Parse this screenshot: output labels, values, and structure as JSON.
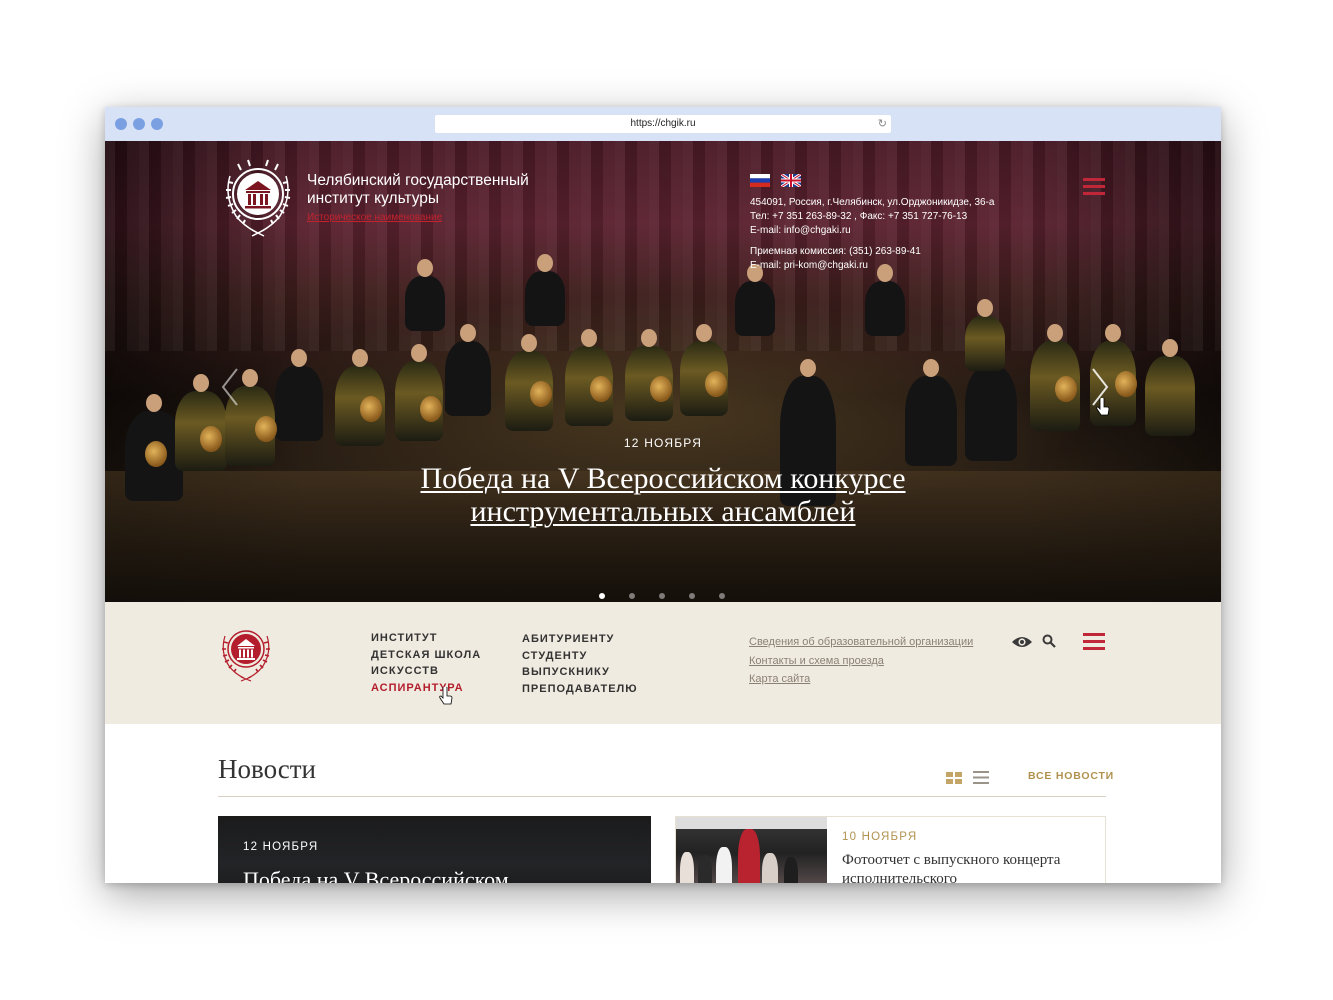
{
  "browser": {
    "url": "https://chgik.ru"
  },
  "header": {
    "institute_name": "Челябинский государственный институт культуры",
    "historical_name_link": "Историческое наименование",
    "contacts": {
      "address": "454091, Россия, г.Челябинск, ул.Орджоникидзе, 36-а",
      "phones": "Тел: +7 351 263-89-32 , Факс: +7 351 727-76-13",
      "email": "E-mail: info@chgaki.ru",
      "admissions": "Приемная комиссия: (351) 263-89-41",
      "admissions_email": "E-mail: pri-kom@chgaki.ru"
    },
    "languages": [
      "ru-flag-icon",
      "uk-flag-icon"
    ]
  },
  "hero": {
    "date": "12 НОЯБРЯ",
    "title": "Победа на V Всероссийском конкурсе инструментальных ансамблей",
    "slides_count": 5,
    "active_slide": 1
  },
  "nav": {
    "col1": [
      "Институт",
      "Детская школа",
      "искусств",
      "Аспирантура"
    ],
    "active_item": "Аспирантура",
    "col2": [
      "Абитуриенту",
      "Студенту",
      "Выпускнику",
      "Преподавателю"
    ],
    "links": [
      "Сведения об образовательной организации",
      "Контакты и схема проезда",
      "Карта сайта"
    ],
    "icons": [
      "eye-icon",
      "search-icon",
      "menu-icon"
    ]
  },
  "news": {
    "heading": "Новости",
    "all_news": "ВСЕ НОВОСТИ",
    "items": [
      {
        "date": "12 НОЯБРЯ",
        "title": "Победа на V Всероссийском"
      },
      {
        "date": "10 НОЯБРЯ",
        "title": "Фотоотчет с выпускного концерта исполнительского"
      }
    ]
  },
  "colors": {
    "accent_red": "#c0283a",
    "nav_background": "#f0ebe0",
    "gold": "#b0924e",
    "browser_chrome": "#d7e2f6"
  }
}
